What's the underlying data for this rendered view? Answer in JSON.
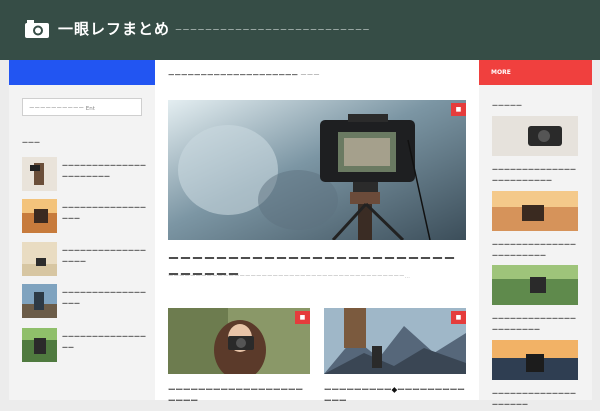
{
  "site": {
    "title": "一眼レフまとめ",
    "tagline": "ーーーーーーーーーーーーーーーーーーーーーーーーーー"
  },
  "search": {
    "placeholder": "ーーーーーーーーーー Ent"
  },
  "left": {
    "widget_title": "ーーー",
    "posts": [
      {
        "title": "ーーーーーーーーーーーーーーーーーーーーーー"
      },
      {
        "title": "ーーーーーーーーーーーーーーーーー"
      },
      {
        "title": "ーーーーーーーーーーーーーーーーーー"
      },
      {
        "title": "ーーーーーーーーーーーーーーーーー"
      },
      {
        "title": "ーーーーーーーーーーーーーーーー"
      }
    ]
  },
  "main": {
    "breadcrumb": "ーーーーーーーーーーーーーーーーーーーー",
    "breadcrumb_sub": "ーーー",
    "hero_badge": "■",
    "hero_title": "ーーーーーーーーーーーーーーーーーーーーーーーーーーーーーー",
    "hero_excerpt": "ーーーーーーーーーーーーーーーーーーーーーーーーーーーーーーーーーーーーーーーーーーー…",
    "cards": [
      {
        "badge": "■",
        "title": "ーーーーーーーーーーーーーーーーーーーーーー"
      },
      {
        "badge": "■",
        "title": "ーーーーーーーーー◆ーーーーーーーーーーーー"
      }
    ]
  },
  "right": {
    "tab_label": "MORE",
    "widget_title": "ーーーーー",
    "posts": [
      {
        "title": "ーーーーーーーーーーーーーーーーーーーーーーーー"
      },
      {
        "title": "ーーーーーーーーーーーーーーーーーーーーーーー"
      },
      {
        "title": "ーーーーーーーーーーーーーーーーーーーーーー"
      },
      {
        "title": "ーーーーーーーーーーーーーーーーーーーー"
      }
    ]
  },
  "colors": {
    "header": "#364d46",
    "left_accent": "#2255f2",
    "right_accent": "#f0403e",
    "badge": "#e53c3c"
  }
}
